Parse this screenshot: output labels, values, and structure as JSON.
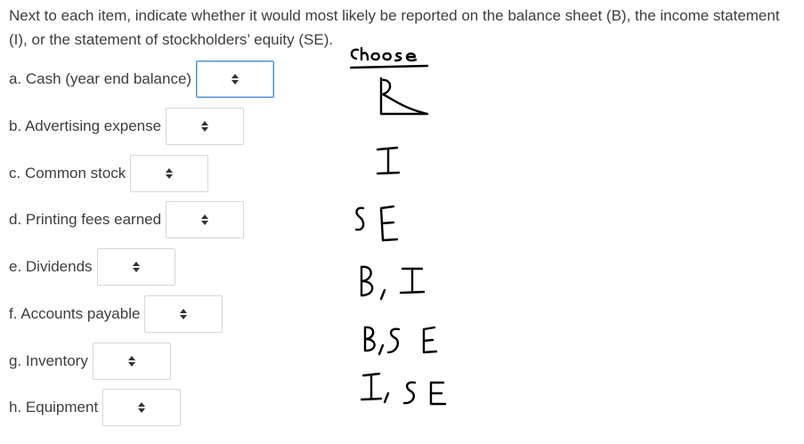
{
  "question": {
    "instructions": "Next to each item, indicate whether it would most likely be reported on the balance sheet (B), the income statement (I), or the statement of stockholders’ equity (SE)."
  },
  "items": [
    {
      "label": "a. Cash (year end balance)",
      "value": ""
    },
    {
      "label": "b. Advertising expense",
      "value": ""
    },
    {
      "label": "c. Common stock",
      "value": ""
    },
    {
      "label": "d. Printing fees earned",
      "value": ""
    },
    {
      "label": "e. Dividends",
      "value": ""
    },
    {
      "label": "f. Accounts payable",
      "value": ""
    },
    {
      "label": "g. Inventory",
      "value": ""
    },
    {
      "label": "h. Equipment",
      "value": ""
    }
  ],
  "handwritten_notes": {
    "heading": "Choose",
    "options": [
      "B",
      "I",
      "SE",
      "B, I",
      "B, SE",
      "I, SE"
    ]
  },
  "icons": {
    "select_arrow": "up-down-caret-icon"
  },
  "colors": {
    "focus_border": "#4a90d9",
    "text": "#3d3d3d",
    "ink": "#000000"
  }
}
